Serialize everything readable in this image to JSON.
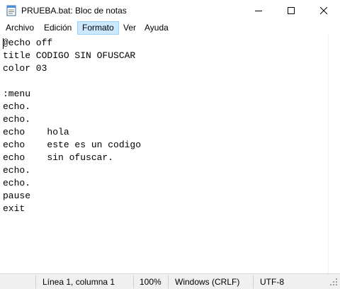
{
  "window": {
    "title": "PRUEBA.bat: Bloc de notas",
    "icons": {
      "app": "notepad-icon",
      "minimize": "minimize-icon",
      "maximize": "maximize-icon",
      "close": "close-icon"
    }
  },
  "menubar": {
    "items": [
      "Archivo",
      "Edición",
      "Formato",
      "Ver",
      "Ayuda"
    ],
    "active": "Formato"
  },
  "editor": {
    "content": "@echo off\ntitle CODIGO SIN OFUSCAR\ncolor 03\n\n:menu\necho.\necho.\necho    hola\necho    este es un codigo\necho    sin ofuscar.\necho.\necho.\npause\nexit"
  },
  "statusbar": {
    "position": "Línea 1, columna 1",
    "zoom": "100%",
    "line_endings": "Windows (CRLF)",
    "encoding": "UTF-8"
  },
  "colors": {
    "active_menu_bg": "#cce8ff",
    "active_menu_border": "#99d1ff",
    "statusbar_bg": "#f0f0f0"
  }
}
